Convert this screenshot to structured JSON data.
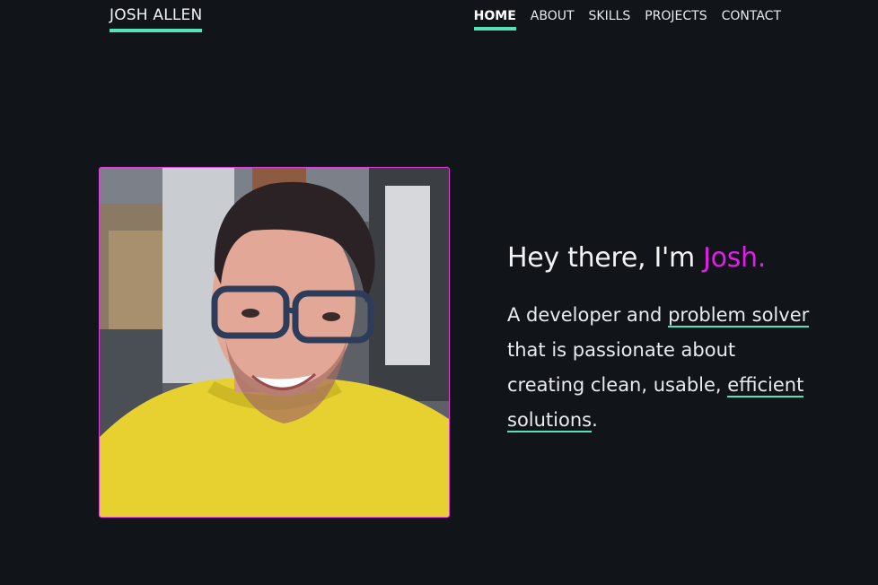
{
  "brand": {
    "name": "JOSH ALLEN"
  },
  "nav": {
    "items": [
      {
        "label": "HOME",
        "active": true
      },
      {
        "label": "ABOUT",
        "active": false
      },
      {
        "label": "SKILLS",
        "active": false
      },
      {
        "label": "PROJECTS",
        "active": false
      },
      {
        "label": "CONTACT",
        "active": false
      }
    ]
  },
  "hero": {
    "greeting": "Hey there, I'm ",
    "name": "Josh.",
    "description": {
      "part1": "A developer and ",
      "link1": "problem solver",
      "part2": " that is passionate about creating clean, usable, ",
      "link2": "efficient solutions",
      "part3": "."
    }
  },
  "colors": {
    "background": "#111418",
    "accent_teal": "#52e3b8",
    "accent_magenta": "#e21de8",
    "text": "#e9ecef"
  }
}
